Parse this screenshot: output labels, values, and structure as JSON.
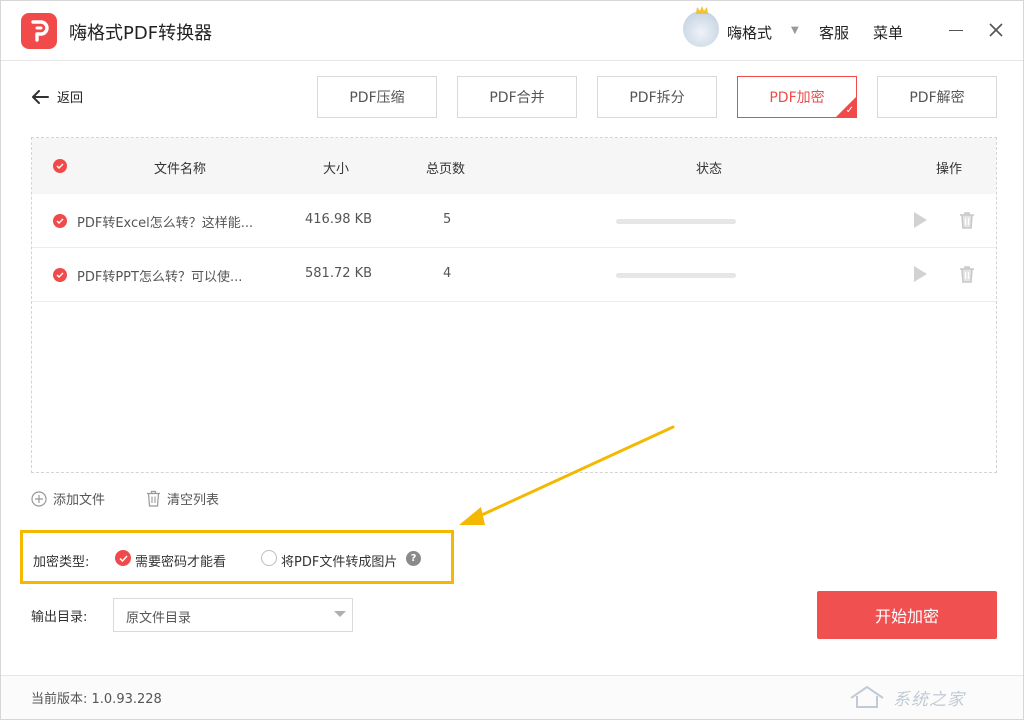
{
  "app": {
    "title": "嗨格式PDF转换器",
    "logo_icon": "app-logo-icon",
    "accent_color": "#f04a4a"
  },
  "header": {
    "username": "嗨格式",
    "kefu_label": "客服",
    "menu_label": "菜单"
  },
  "nav": {
    "back_label": "返回",
    "tools": [
      {
        "label": "PDF压缩",
        "active": false
      },
      {
        "label": "PDF合并",
        "active": false
      },
      {
        "label": "PDF拆分",
        "active": false
      },
      {
        "label": "PDF加密",
        "active": true
      },
      {
        "label": "PDF解密",
        "active": false
      }
    ]
  },
  "table": {
    "headers": {
      "name": "文件名称",
      "size": "大小",
      "pages": "总页数",
      "status": "状态",
      "actions": "操作"
    },
    "rows": [
      {
        "name": "PDF转Excel怎么转？这样能...",
        "size": "416.98 KB",
        "pages": "5"
      },
      {
        "name": "PDF转PPT怎么转？可以使...",
        "size": "581.72 KB",
        "pages": "4"
      }
    ]
  },
  "list_actions": {
    "add_label": "添加文件",
    "clear_label": "清空列表"
  },
  "encryption": {
    "label": "加密类型:",
    "option_password": "需要密码才能看",
    "option_image": "将PDF文件转成图片",
    "help": "?",
    "highlight_color": "#f5b800"
  },
  "output": {
    "label": "输出目录:",
    "selected": "原文件目录"
  },
  "start_label": "开始加密",
  "footer": {
    "version": "当前版本: 1.0.93.228",
    "watermark": "系统之家"
  }
}
